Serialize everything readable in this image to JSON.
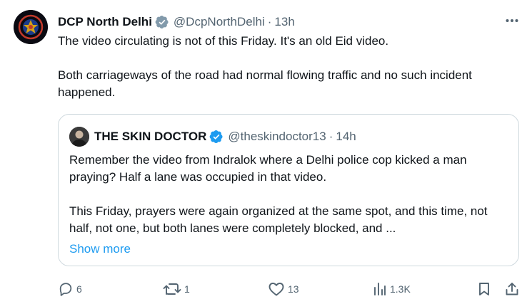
{
  "tweet": {
    "author_name": "DCP North Delhi",
    "handle": "@DcpNorthDelhi",
    "separator": "·",
    "time": "13h",
    "paragraphs": [
      "The video circulating is not of this Friday. It's an old Eid video.",
      "Both carriageways of the road had normal flowing traffic and no such incident happened."
    ],
    "verified_badge_color": "#829aab",
    "more_icon": "more-horizontal-icon"
  },
  "quote": {
    "author_name": "THE SKIN DOCTOR",
    "handle": "@theskindoctor13",
    "separator": "·",
    "time": "14h",
    "verified_badge_color": "#1d9bf0",
    "paragraphs": [
      "Remember the video from Indralok where a Delhi police cop kicked a man praying? Half a lane was occupied in that video.",
      "This Friday, prayers were again organized at the same spot, and this time, not half, not one, but both lanes were completely blocked, and ..."
    ],
    "show_more": "Show more"
  },
  "actions": {
    "reply_count": "6",
    "retweet_count": "1",
    "like_count": "13",
    "views_count": "1.3K"
  },
  "colors": {
    "text_primary": "#0f1419",
    "text_secondary": "#536471",
    "link": "#1d9bf0",
    "border": "#cfd9de"
  }
}
